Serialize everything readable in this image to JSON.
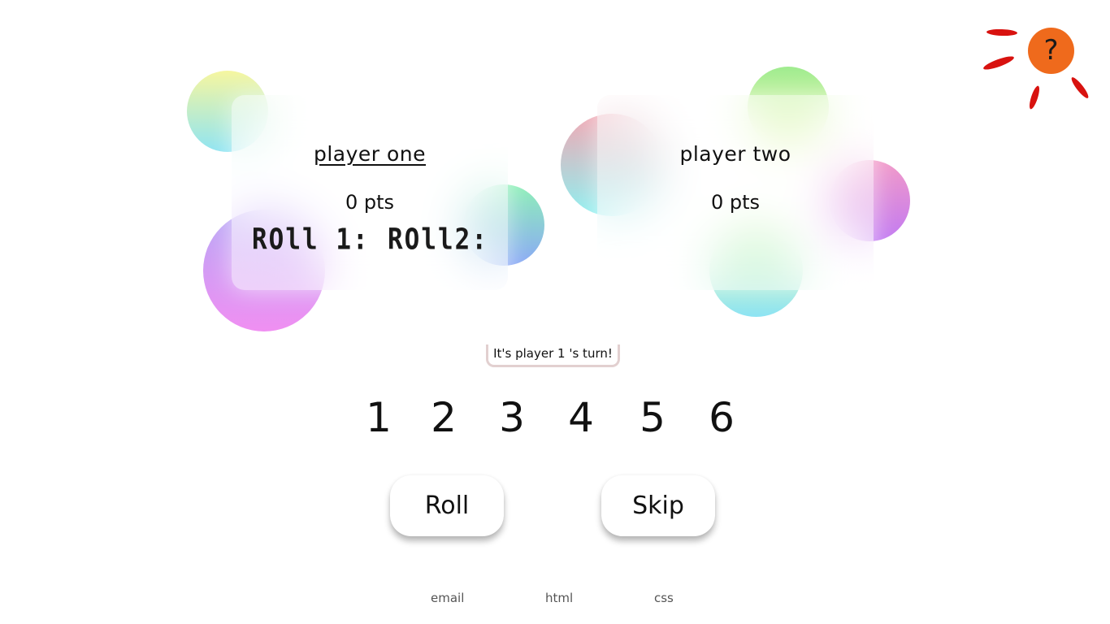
{
  "players": [
    {
      "name": "player one",
      "points": "0 pts",
      "roll1_label": "ROll 1:",
      "roll2_label": "ROll2:",
      "active": true
    },
    {
      "name": "player two",
      "points": "0 pts",
      "active": false
    }
  ],
  "turn_message": "It's player 1 's turn!",
  "dice_values": [
    "1",
    "2",
    "3",
    "4",
    "5",
    "6"
  ],
  "buttons": {
    "roll": "Roll",
    "skip": "Skip"
  },
  "help": {
    "label": "?",
    "icon": "question-mark-icon"
  },
  "footer": {
    "email": "email",
    "html": "html",
    "css": "css"
  },
  "colors": {
    "help_button": "#ef6a1c",
    "sun_rays": "#d8120f",
    "text": "#111111",
    "footer_text": "#555555",
    "turn_banner_border": "#e2d0d0"
  }
}
